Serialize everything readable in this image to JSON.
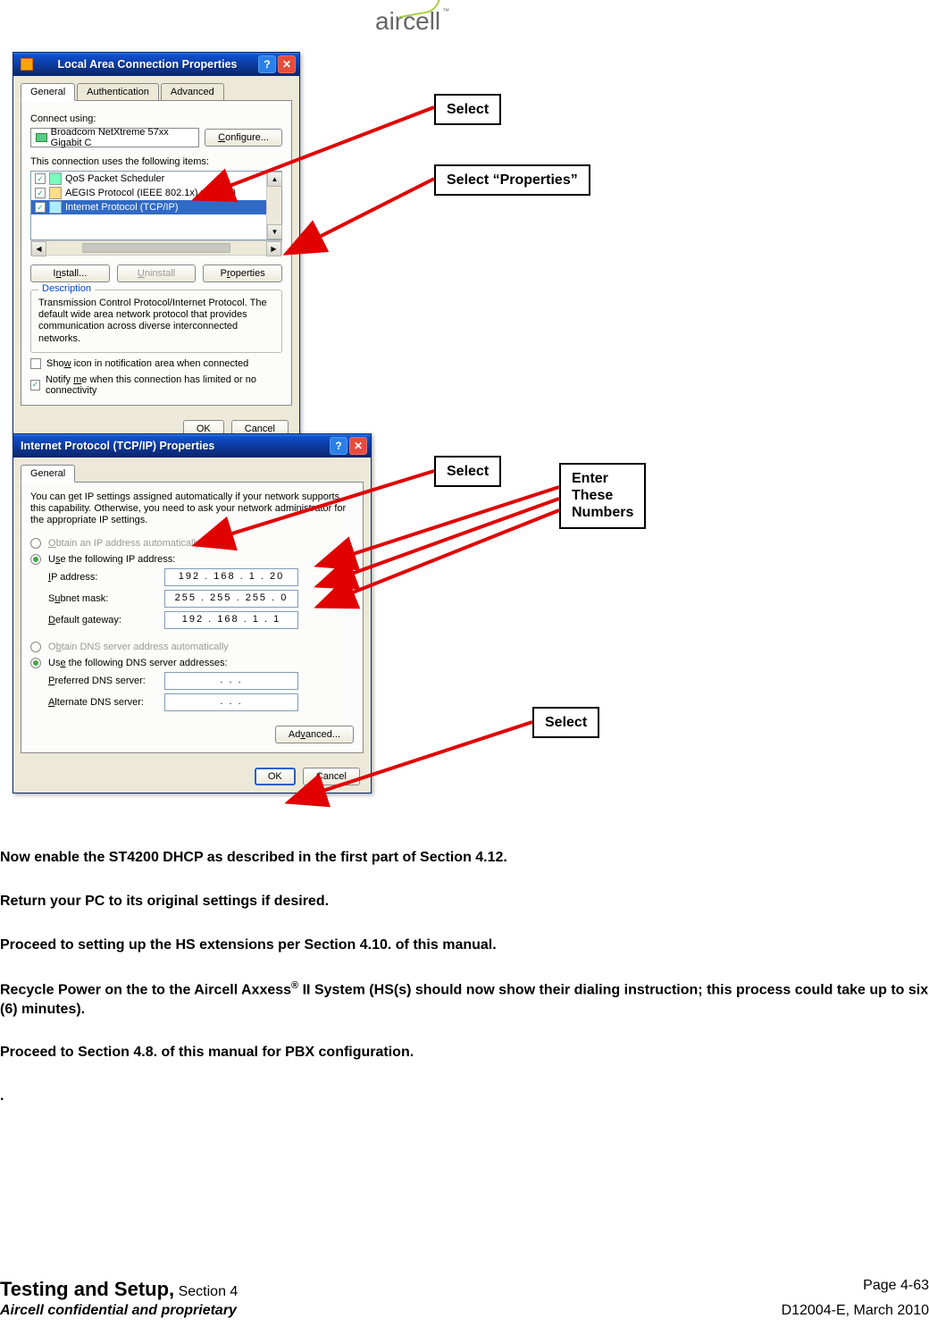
{
  "logo_text": "aircell",
  "win1": {
    "title": "Local Area Connection Properties",
    "tab_general": "General",
    "tab_auth": "Authentication",
    "tab_adv": "Advanced",
    "connect_using": "Connect using:",
    "adapter": "Broadcom NetXtreme 57xx Gigabit C",
    "configure": "Configure...",
    "uses_items": "This connection uses the following items:",
    "item1": "QoS Packet Scheduler",
    "item2": "AEGIS Protocol (IEEE 802.1x) v3.5.3.0",
    "item3": "Internet Protocol (TCP/IP)",
    "install": "Install...",
    "uninstall": "Uninstall",
    "properties": "Properties",
    "desc_legend": "Description",
    "desc_text": "Transmission Control Protocol/Internet Protocol. The default wide area network protocol that provides communication across diverse interconnected networks.",
    "show_icon": "Show icon in notification area when connected",
    "notify": "Notify me when this connection has limited or no connectivity",
    "ok": "OK",
    "cancel": "Cancel"
  },
  "win2": {
    "title": "Internet Protocol (TCP/IP) Properties",
    "tab_general": "General",
    "blurb": "You can get IP settings assigned automatically if your network supports this capability. Otherwise, you need to ask your network administrator for the appropriate IP settings.",
    "opt_obtain_ip": "Obtain an IP address automatically",
    "opt_use_ip": "Use the following IP address:",
    "ip_label": "IP address:",
    "ip_value": "192 . 168 .   1  .  20",
    "subnet_label": "Subnet mask:",
    "subnet_value": "255 . 255 . 255 .   0",
    "gw_label": "Default gateway:",
    "gw_value": "192 . 168 .   1  .   1",
    "opt_obtain_dns": "Obtain DNS server address automatically",
    "opt_use_dns": "Use the following DNS server addresses:",
    "pref_dns_label": "Preferred DNS server:",
    "pref_dns_value": ".        .        .",
    "alt_dns_label": "Alternate DNS server:",
    "alt_dns_value": ".        .        .",
    "advanced": "Advanced...",
    "ok": "OK",
    "cancel": "Cancel"
  },
  "callouts": {
    "c1": "Select",
    "c2": "Select “Properties”",
    "c3": "Select",
    "c4a": "Enter",
    "c4b": "These",
    "c4c": "Numbers",
    "c5": "Select"
  },
  "instructions": {
    "p1": "Now enable the ST4200 DHCP as described in the first part of Section 4.12.",
    "p2": "Return your PC to its original settings if desired.",
    "p3": "Proceed to setting up the HS extensions per Section 4.10. of this manual.",
    "p4": "Recycle Power on the to the Aircell Axxess® II System (HS(s) should now show their dialing instruction; this process could take up to six (6) minutes).",
    "p5": "Proceed to Section 4.8. of this manual for PBX configuration.",
    "p6": "."
  },
  "footer": {
    "section": "Testing and Setup,",
    "section_sub": " Section 4",
    "page": "Page 4-63",
    "confidential": "Aircell confidential and proprietary",
    "docid": "D12004-E, March 2010"
  }
}
